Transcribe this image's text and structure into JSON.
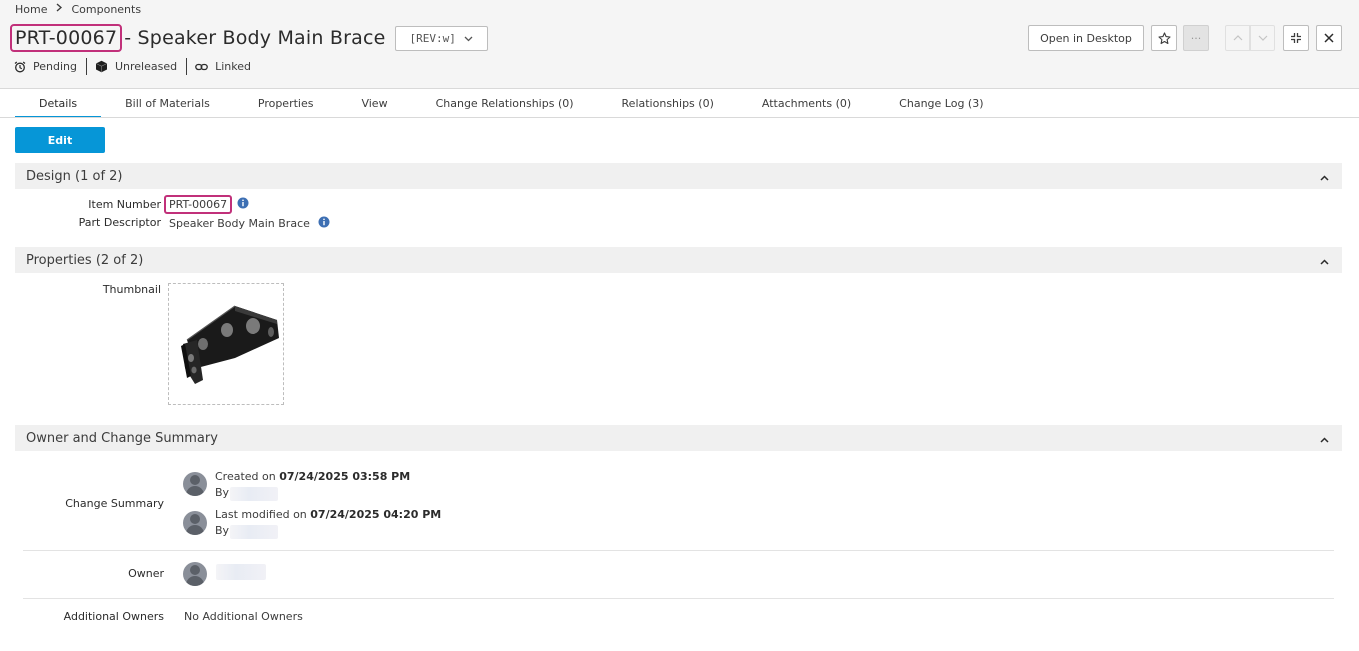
{
  "breadcrumb": {
    "home": "Home",
    "section": "Components"
  },
  "title": {
    "number": "PRT-00067",
    "rest": "- Speaker Body Main Brace"
  },
  "revision": {
    "value": "[REV:w]"
  },
  "status": {
    "lifecycle": "Pending",
    "release": "Unreleased",
    "link": "Linked"
  },
  "toolbar": {
    "open_desktop": "Open in Desktop",
    "more_label": "···"
  },
  "tabs": [
    {
      "label": "Details"
    },
    {
      "label": "Bill of Materials"
    },
    {
      "label": "Properties"
    },
    {
      "label": "View"
    },
    {
      "label": "Change Relationships (0)"
    },
    {
      "label": "Relationships (0)"
    },
    {
      "label": "Attachments (0)"
    },
    {
      "label": "Change Log (3)"
    }
  ],
  "edit_label": "Edit",
  "sections": {
    "design": {
      "title": "Design (1 of 2)",
      "item_number_label": "Item Number",
      "item_number_value": "PRT-00067",
      "part_descriptor_label": "Part Descriptor",
      "part_descriptor_value": "Speaker Body Main Brace"
    },
    "properties": {
      "title": "Properties (2 of 2)",
      "thumbnail_label": "Thumbnail"
    },
    "owner": {
      "title": "Owner and Change Summary",
      "change_summary_label": "Change Summary",
      "created_prefix": "Created on ",
      "created_date": "07/24/2025 03:58 PM",
      "by_label": "By",
      "modified_prefix": "Last modified on ",
      "modified_date": "07/24/2025 04:20 PM",
      "owner_label": "Owner",
      "additional_owners_label": "Additional Owners",
      "additional_owners_value": "No Additional Owners"
    }
  },
  "colors": {
    "accent": "#0696d7",
    "highlight": "#c1307a",
    "info": "#3d6fb3"
  }
}
